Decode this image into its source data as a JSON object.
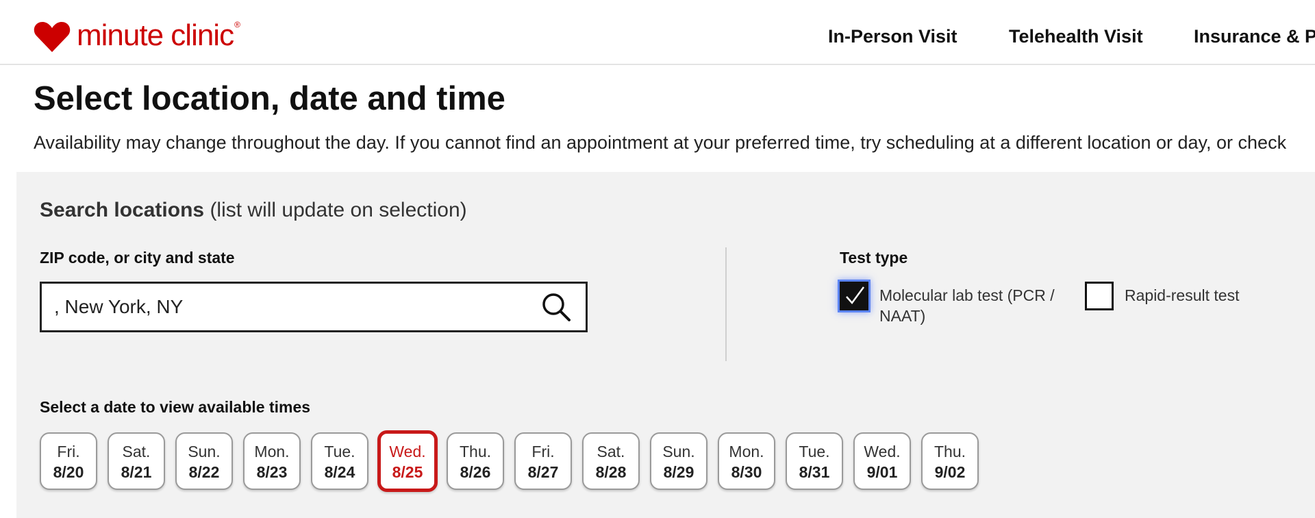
{
  "brand": {
    "name": "minute clinic",
    "registered_mark": "®",
    "color": "#cc0000"
  },
  "nav": {
    "items": [
      {
        "label": "In-Person Visit"
      },
      {
        "label": "Telehealth Visit"
      },
      {
        "label": "Insurance & P"
      }
    ]
  },
  "page": {
    "title": "Select location, date and time",
    "subtitle": "Availability may change throughout the day. If you cannot find an appointment at your preferred time, try scheduling at a different location or day, or check"
  },
  "search": {
    "heading_bold": "Search locations",
    "heading_note": "(list will update on selection)",
    "zip_label": "ZIP code, or city and state",
    "zip_value": ", New York, NY",
    "search_icon": "search-icon"
  },
  "test_type": {
    "label": "Test type",
    "options": [
      {
        "label": "Molecular lab test (PCR / NAAT)",
        "checked": true
      },
      {
        "label": "Rapid-result test",
        "checked": false
      }
    ]
  },
  "dates": {
    "label": "Select a date to view available times",
    "selected_index": 5,
    "selected_color": "#c81919",
    "items": [
      {
        "day": "Fri.",
        "date": "8/20"
      },
      {
        "day": "Sat.",
        "date": "8/21"
      },
      {
        "day": "Sun.",
        "date": "8/22"
      },
      {
        "day": "Mon.",
        "date": "8/23"
      },
      {
        "day": "Tue.",
        "date": "8/24"
      },
      {
        "day": "Wed.",
        "date": "8/25"
      },
      {
        "day": "Thu.",
        "date": "8/26"
      },
      {
        "day": "Fri.",
        "date": "8/27"
      },
      {
        "day": "Sat.",
        "date": "8/28"
      },
      {
        "day": "Sun.",
        "date": "8/29"
      },
      {
        "day": "Mon.",
        "date": "8/30"
      },
      {
        "day": "Tue.",
        "date": "8/31"
      },
      {
        "day": "Wed.",
        "date": "9/01"
      },
      {
        "day": "Thu.",
        "date": "9/02"
      }
    ]
  }
}
